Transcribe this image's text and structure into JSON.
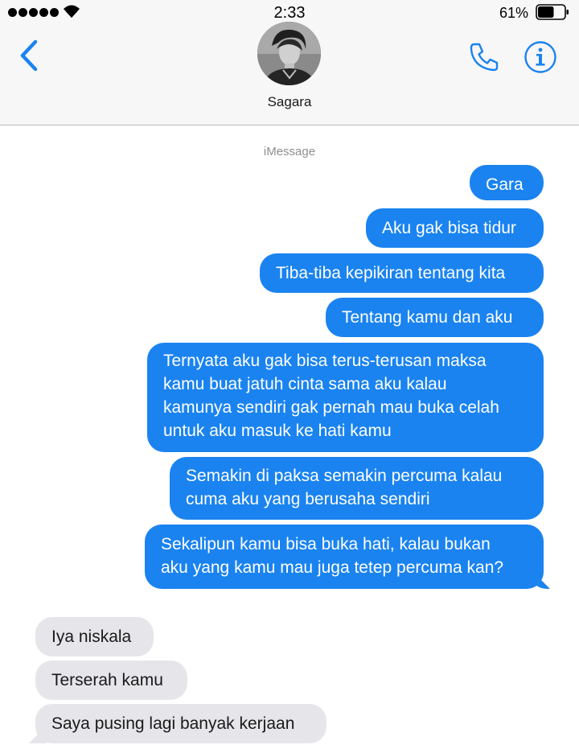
{
  "status_bar": {
    "time": "2:33",
    "battery_percent": "61%",
    "signal_bars": 5,
    "battery_level": 0.61,
    "icons": [
      "signal-dots",
      "wifi-icon",
      "battery-icon"
    ]
  },
  "header": {
    "contact_name": "Sagara",
    "back_icon": "chevron-left-icon",
    "call_icon": "phone-icon",
    "info_icon": "info-icon",
    "accent_color": "#1a83f0"
  },
  "thread": {
    "service_label": "iMessage",
    "sent_color": "#1a83f0",
    "received_color": "#e5e5ea",
    "messages": [
      {
        "direction": "sent",
        "text": "Gara"
      },
      {
        "direction": "sent",
        "text": "Aku gak bisa tidur"
      },
      {
        "direction": "sent",
        "text": "Tiba-tiba kepikiran tentang kita"
      },
      {
        "direction": "sent",
        "text": "Tentang kamu dan aku"
      },
      {
        "direction": "sent",
        "text": "Ternyata aku gak bisa terus-terusan maksa\nkamu buat jatuh cinta sama aku kalau\nkamunya sendiri gak pernah mau buka celah\nuntuk aku masuk ke hati kamu"
      },
      {
        "direction": "sent",
        "text": "Semakin di paksa semakin percuma kalau\ncuma aku yang berusaha sendiri"
      },
      {
        "direction": "sent",
        "text": "Sekalipun kamu bisa buka hati, kalau bukan\naku yang kamu mau juga tetep percuma kan?"
      },
      {
        "direction": "received",
        "text": "Iya niskala"
      },
      {
        "direction": "received",
        "text": "Terserah kamu"
      },
      {
        "direction": "received",
        "text": "Saya pusing lagi banyak kerjaan"
      }
    ]
  }
}
